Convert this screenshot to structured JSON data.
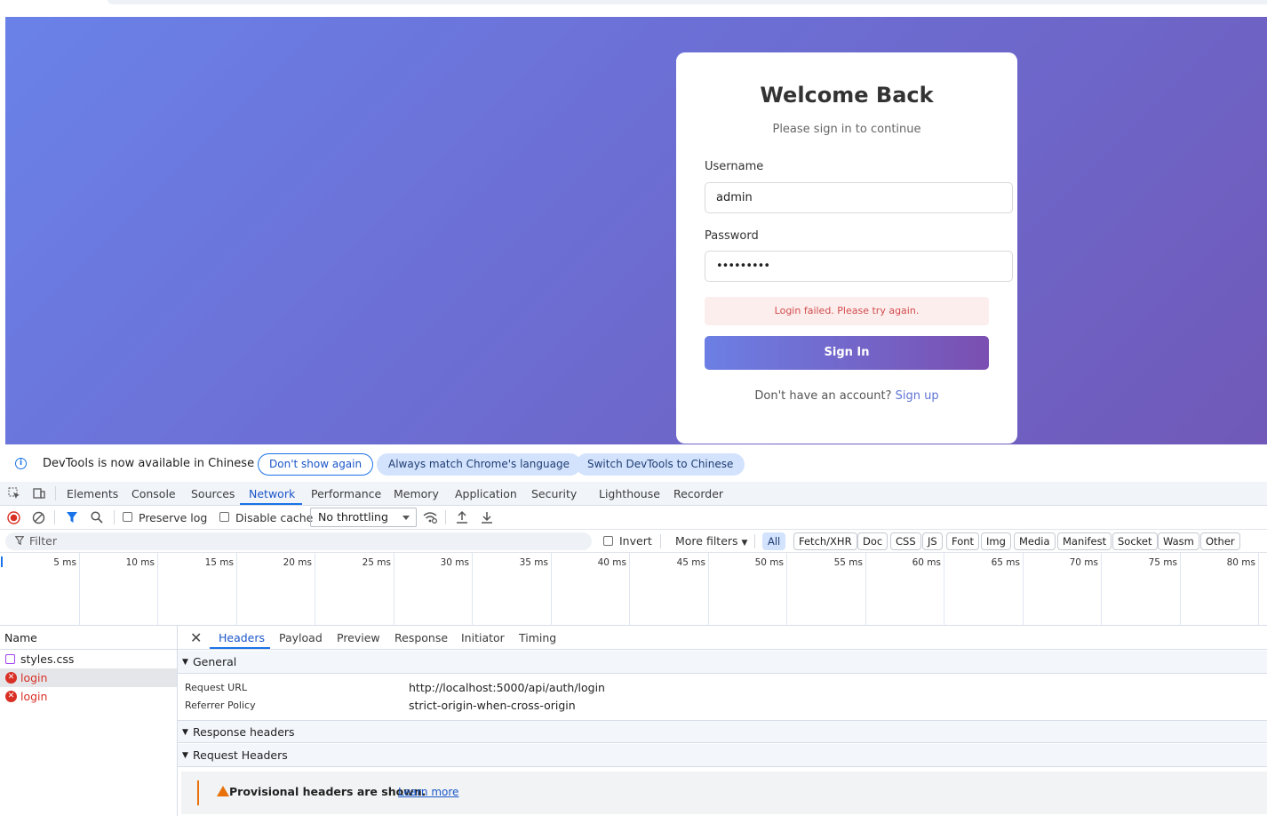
{
  "login_card": {
    "title": "Welcome Back",
    "subtitle": "Please sign in to continue",
    "username_label": "Username",
    "username_value": "admin",
    "password_label": "Password",
    "password_value": "•••••••••",
    "error_message": "Login failed. Please try again.",
    "signin_label": "Sign In",
    "signup_prompt": "Don't have an account?",
    "signup_link": "Sign up"
  },
  "infobar": {
    "message": "DevTools is now available in Chinese",
    "dont_show": "Don't show again",
    "always_match": "Always match Chrome's language",
    "switch": "Switch DevTools to Chinese"
  },
  "devtools_tabs": [
    "Elements",
    "Console",
    "Sources",
    "Network",
    "Performance",
    "Memory",
    "Application",
    "Security",
    "Lighthouse",
    "Recorder"
  ],
  "network_toolbar": {
    "preserve_log": "Preserve log",
    "disable_cache": "Disable cache",
    "throttling": "No throttling"
  },
  "filter_bar": {
    "placeholder": "Filter",
    "invert": "Invert",
    "more_filters": "More filters",
    "types": [
      "All",
      "Fetch/XHR",
      "Doc",
      "CSS",
      "JS",
      "Font",
      "Img",
      "Media",
      "Manifest",
      "Socket",
      "Wasm",
      "Other"
    ]
  },
  "timeline_ticks": [
    "5 ms",
    "10 ms",
    "15 ms",
    "20 ms",
    "25 ms",
    "30 ms",
    "35 ms",
    "40 ms",
    "45 ms",
    "50 ms",
    "55 ms",
    "60 ms",
    "65 ms",
    "70 ms",
    "75 ms",
    "80 ms"
  ],
  "request_list": {
    "header": "Name",
    "rows": [
      "styles.css",
      "login",
      "login"
    ]
  },
  "detail": {
    "tabs": [
      "Headers",
      "Payload",
      "Preview",
      "Response",
      "Initiator",
      "Timing"
    ],
    "general_header": "General",
    "request_url_key": "Request URL",
    "request_url_value": "http://localhost:5000/api/auth/login",
    "referrer_key": "Referrer Policy",
    "referrer_value": "strict-origin-when-cross-origin",
    "response_headers": "Response headers",
    "request_headers": "Request Headers",
    "provisional_text": "Provisional headers are shown.",
    "learn_more": "Learn more"
  },
  "colors": {
    "accent": "#1a73e8",
    "error": "#d93025",
    "gradient_start": "#6a82e8",
    "gradient_end": "#7059b8"
  }
}
